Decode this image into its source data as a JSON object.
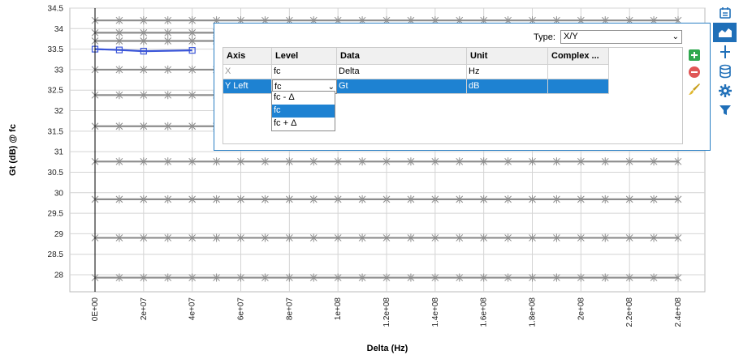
{
  "chart_data": {
    "type": "line",
    "xlabel": "Delta (Hz)",
    "ylabel": "Gt (dB) @ fc",
    "xlim": [
      0,
      240000000
    ],
    "ylim": [
      27.7,
      34.5
    ],
    "x_ticks": [
      "0E+00",
      "2e+07",
      "4e+07",
      "6e+07",
      "8e+07",
      "1e+08",
      "1.2e+08",
      "1.4e+08",
      "1.6e+08",
      "1.8e+08",
      "2e+08",
      "2.2e+08",
      "2.4e+08"
    ],
    "y_ticks": [
      "28",
      "28.5",
      "29",
      "29.5",
      "30",
      "30.5",
      "31",
      "31.5",
      "32",
      "32.5",
      "33",
      "33.5",
      "34",
      "34.5"
    ],
    "x": [
      0,
      10000000,
      20000000,
      40000000,
      60000000,
      80000000,
      100000000,
      120000000,
      140000000,
      160000000,
      180000000,
      200000000,
      220000000,
      240000000
    ],
    "series": [
      {
        "values": [
          34.2,
          34.2,
          34.2,
          34.2,
          34.2,
          34.2,
          34.2,
          34.2,
          34.2,
          34.2,
          34.2,
          34.2,
          34.2,
          34.2
        ]
      },
      {
        "values": [
          33.9,
          33.9,
          33.9,
          33.9,
          33.9,
          33.9,
          33.9,
          33.9,
          33.9,
          33.9,
          33.9,
          33.9,
          33.9,
          33.9
        ]
      },
      {
        "values": [
          33.7,
          33.7,
          33.7,
          33.7,
          33.7,
          33.7,
          33.7,
          33.7,
          33.7,
          33.7,
          33.7,
          33.7,
          33.7,
          33.7
        ]
      },
      {
        "values": [
          33.0,
          33.0,
          33.0,
          33.0,
          33.0,
          33.0,
          33.0,
          33.0,
          33.0,
          33.0,
          33.0,
          33.0,
          33.0,
          33.0
        ]
      },
      {
        "values": [
          32.38,
          32.38,
          32.38,
          32.38,
          32.38,
          32.38,
          32.38,
          32.38,
          32.38,
          32.38,
          32.38,
          32.38,
          32.38,
          32.38
        ]
      },
      {
        "values": [
          31.62,
          31.62,
          31.62,
          31.62,
          31.62,
          31.62,
          31.62,
          31.62,
          31.62,
          31.62,
          31.62,
          31.62,
          31.62,
          31.62
        ]
      },
      {
        "values": [
          30.76,
          30.76,
          30.76,
          30.76,
          30.76,
          30.76,
          30.76,
          30.76,
          30.76,
          30.76,
          30.76,
          30.76,
          30.76,
          30.76
        ]
      },
      {
        "values": [
          29.84,
          29.84,
          29.84,
          29.84,
          29.84,
          29.84,
          29.84,
          29.84,
          29.84,
          29.84,
          29.84,
          29.84,
          29.84,
          29.84
        ]
      },
      {
        "values": [
          28.9,
          28.9,
          28.9,
          28.9,
          28.9,
          28.9,
          28.9,
          28.9,
          28.9,
          28.9,
          28.9,
          28.9,
          28.9,
          28.9
        ]
      },
      {
        "values": [
          27.93,
          27.93,
          27.93,
          27.93,
          27.93,
          27.93,
          27.93,
          27.93,
          27.93,
          27.93,
          27.93,
          27.93,
          27.93,
          27.93
        ]
      },
      {
        "values": [
          33.5,
          33.48,
          33.45,
          33.47,
          33.48,
          33.48,
          33.48,
          33.48,
          33.48,
          33.48,
          33.48,
          33.48,
          33.48,
          33.48
        ],
        "highlighted": true
      }
    ],
    "series_color": "#8c8c8c",
    "highlight_color": "#3a55d8",
    "marker": "asterisk",
    "grid": true
  },
  "toolbar": {
    "buttons": [
      {
        "icon": "dataset-icon",
        "active": false
      },
      {
        "icon": "chart-area-icon",
        "active": true
      },
      {
        "icon": "marker-icon",
        "active": false
      },
      {
        "icon": "database-icon",
        "active": false
      },
      {
        "icon": "gear-icon",
        "active": false
      },
      {
        "icon": "filter-icon",
        "active": false
      }
    ]
  },
  "panel": {
    "type_label": "Type:",
    "type_value": "X/Y",
    "columns": [
      "Axis",
      "Level",
      "Data",
      "Unit",
      "Complex ..."
    ],
    "rows": [
      {
        "axis": "X",
        "level": "fc",
        "data": "Delta",
        "unit": "Hz",
        "complex": ""
      },
      {
        "axis": "Y Left",
        "level": "fc",
        "data": "Gt",
        "unit": "dB",
        "complex": ""
      }
    ],
    "level_options": [
      "fc - Δ",
      "fc",
      "fc + Δ"
    ],
    "level_selected_index": 1,
    "side_buttons": [
      "add-icon",
      "remove-icon",
      "brush-icon"
    ]
  }
}
